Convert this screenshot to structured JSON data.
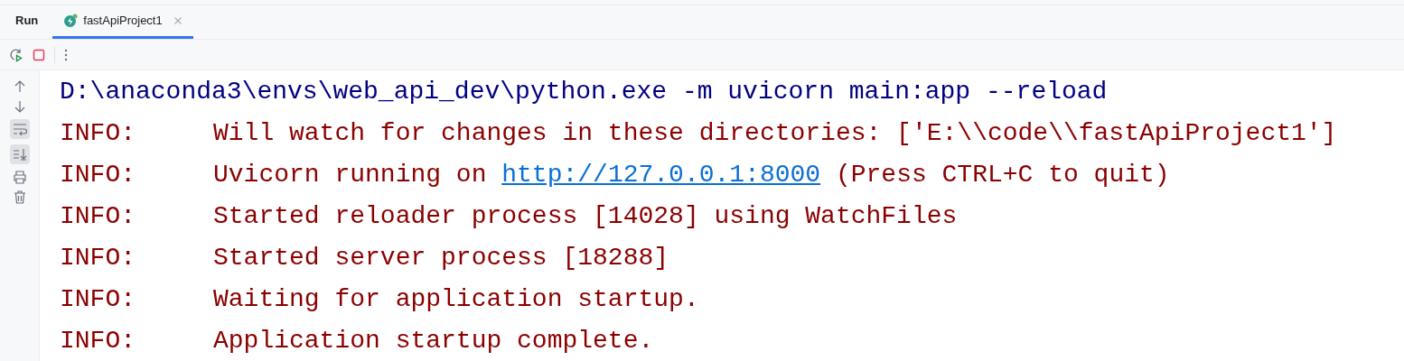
{
  "panel": {
    "title": "Run"
  },
  "tabs": [
    {
      "label": "fastApiProject1",
      "selected": true
    }
  ],
  "console": {
    "lines": [
      {
        "kind": "command",
        "text": "D:\\anaconda3\\envs\\web_api_dev\\python.exe -m uvicorn main:app --reload"
      },
      {
        "kind": "log",
        "prefix": "INFO:",
        "message": "Will watch for changes in these directories: ['E:\\\\code\\\\fastApiProject1']"
      },
      {
        "kind": "log",
        "prefix": "INFO:",
        "message": "Uvicorn running on ",
        "link": "http://127.0.0.1:8000",
        "message_after": " (Press CTRL+C to quit)"
      },
      {
        "kind": "log",
        "prefix": "INFO:",
        "message": "Started reloader process [14028] using WatchFiles"
      },
      {
        "kind": "log",
        "prefix": "INFO:",
        "message": "Started server process [18288]"
      },
      {
        "kind": "log",
        "prefix": "INFO:",
        "message": "Waiting for application startup."
      },
      {
        "kind": "log",
        "prefix": "INFO:",
        "message": "Application startup complete."
      }
    ]
  }
}
